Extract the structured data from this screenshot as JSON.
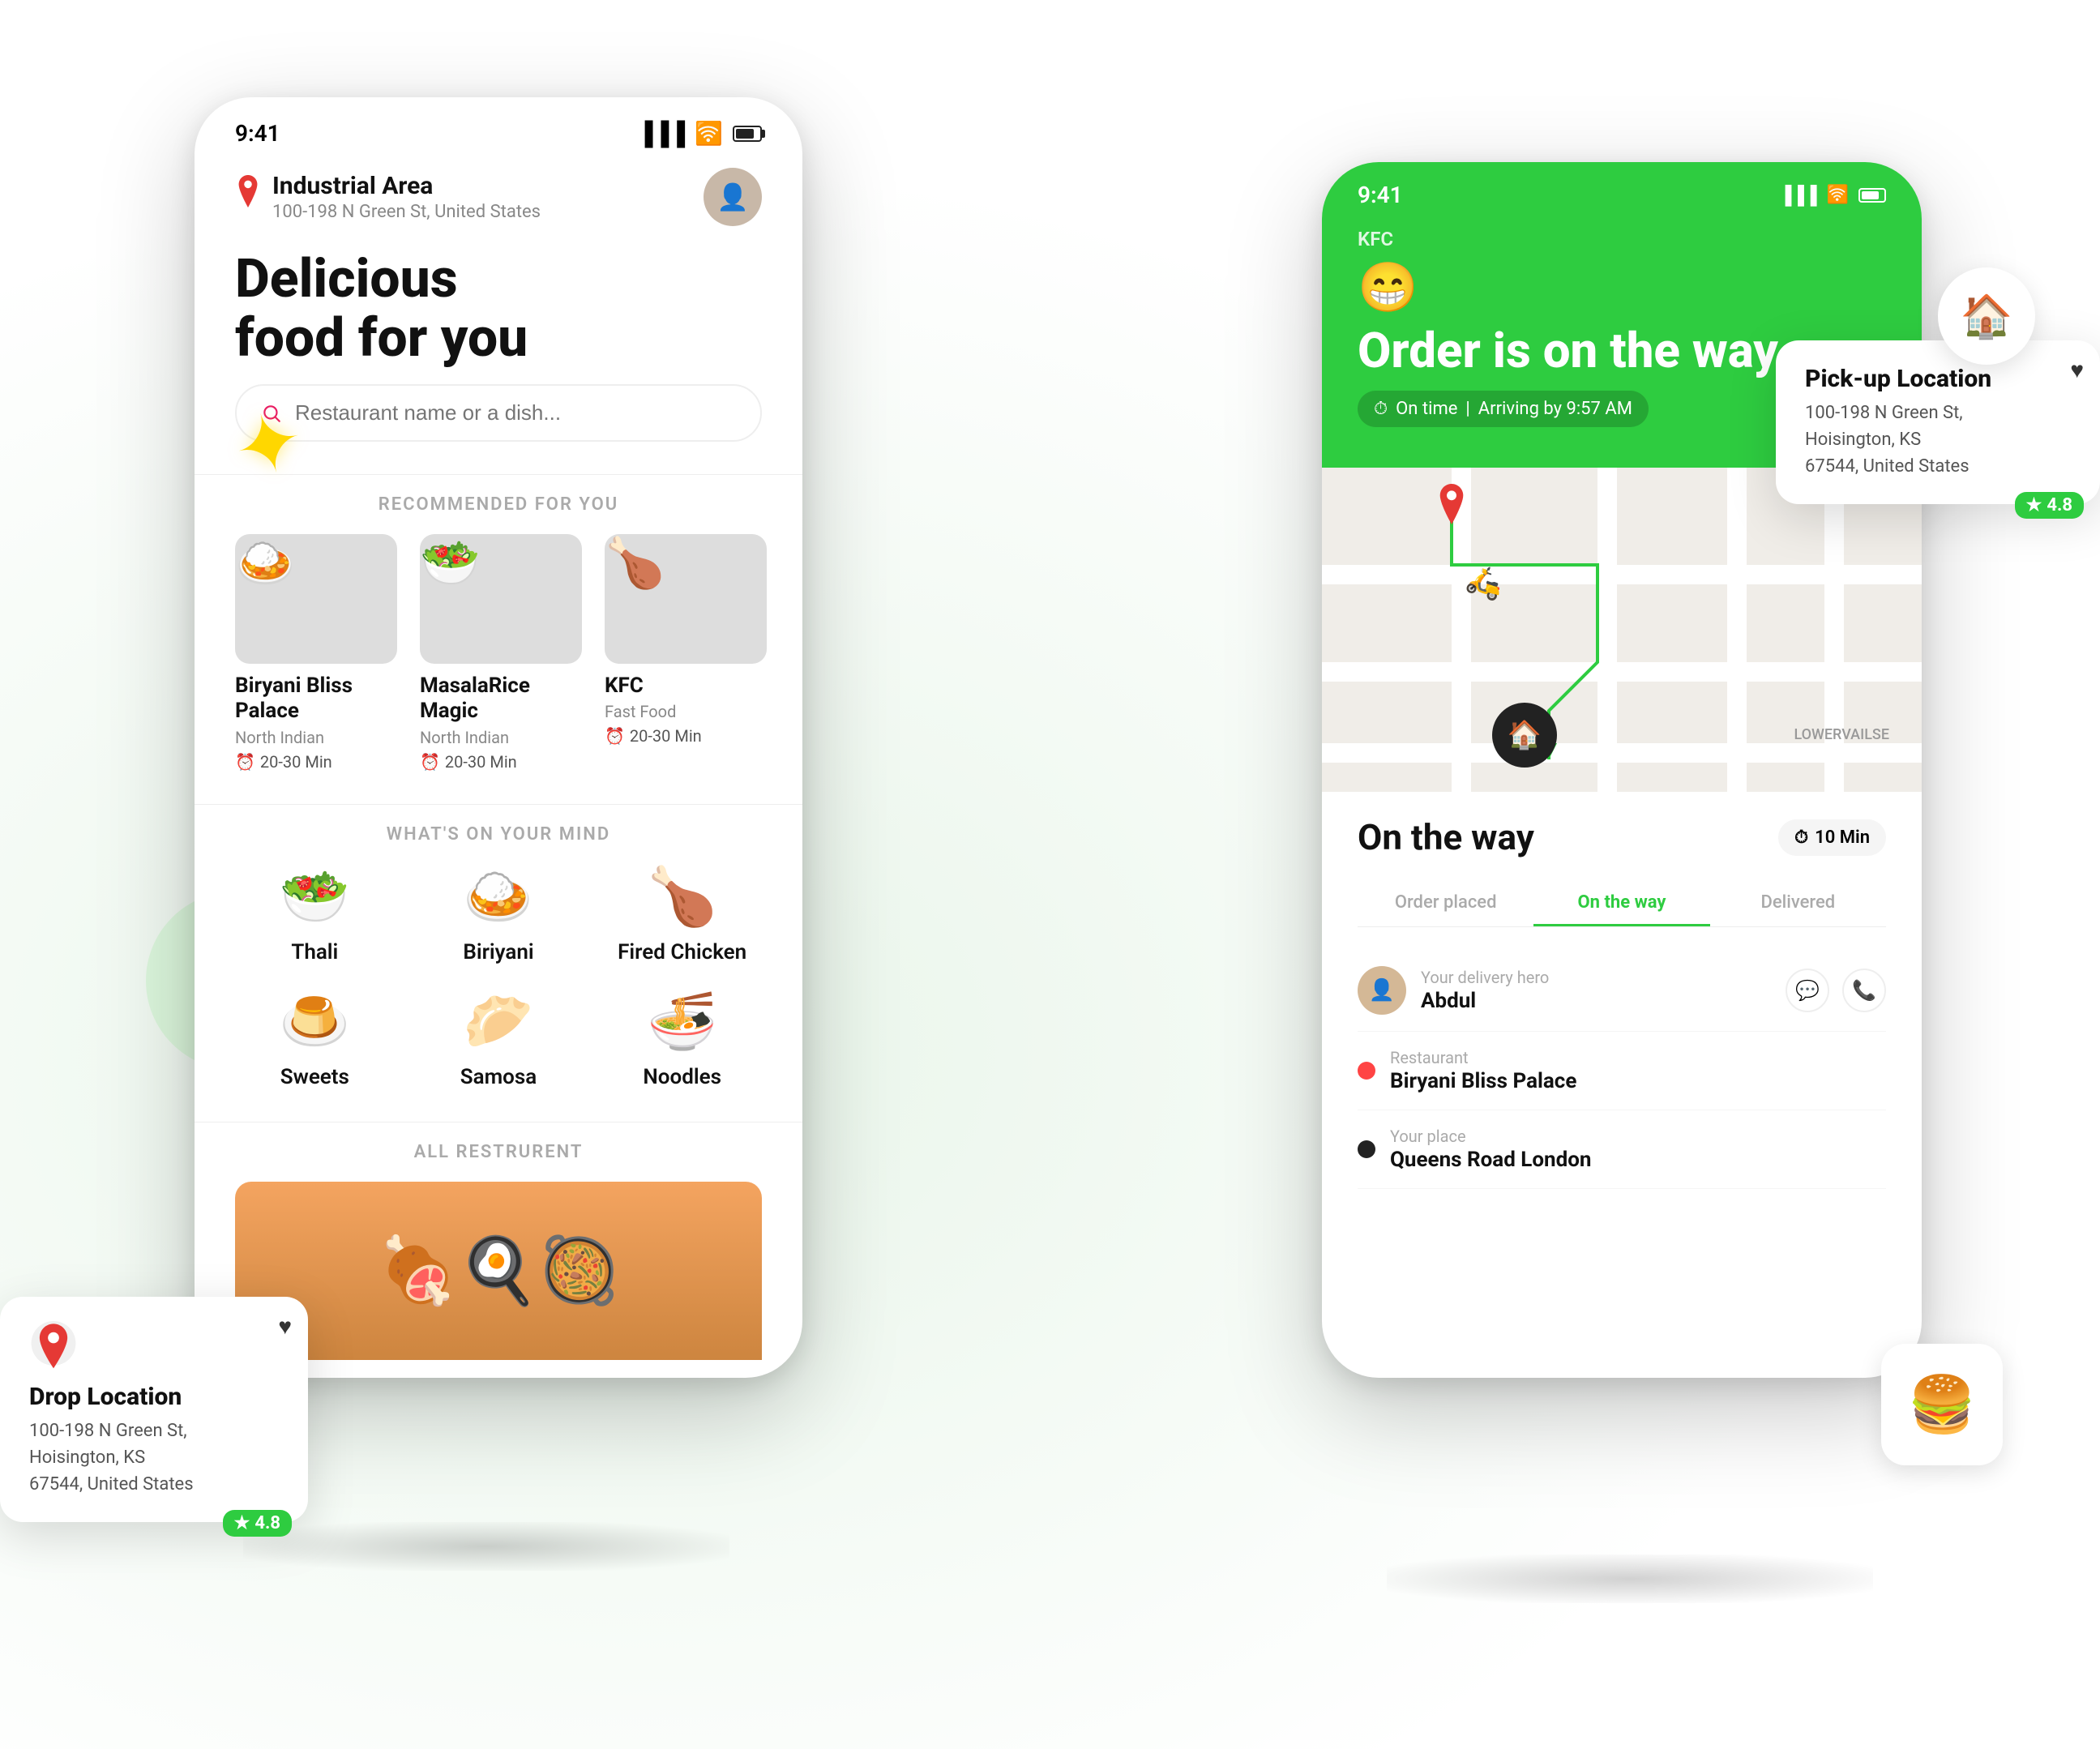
{
  "phone_main": {
    "status_time": "9:41",
    "location_name": "Industrial Area",
    "location_address": "100-198 N Green St, United States",
    "heading_line1": "Delicious",
    "heading_line2": "food for you",
    "search_placeholder": "Restaurant name or a dish...",
    "sections": {
      "recommended_label": "RECOMMENDED FOR YOU",
      "whats_on_mind_label": "WHAT'S ON YOUR MIND",
      "all_restaurant_label": "ALL RESTRURENT"
    },
    "restaurants": [
      {
        "name": "Biryani Bliss Palace",
        "cuisine": "North Indian",
        "time": "20-30 Min",
        "emoji": "🍛"
      },
      {
        "name": "MasalaRice Magic",
        "cuisine": "North Indian",
        "time": "20-30 Min",
        "emoji": "🥗"
      },
      {
        "name": "KFC",
        "cuisine": "Fast Food",
        "time": "20-30 Min",
        "emoji": "🍗"
      }
    ],
    "categories": [
      {
        "name": "Thali",
        "emoji": "🥗"
      },
      {
        "name": "Biriyani",
        "emoji": "🍛"
      },
      {
        "name": "Fired Chicken",
        "emoji": "🍗"
      },
      {
        "name": "Sweets",
        "emoji": "🍮"
      },
      {
        "name": "Samosa",
        "emoji": "🥟"
      },
      {
        "name": "Noodles",
        "emoji": "🍜"
      }
    ]
  },
  "phone_order": {
    "status_time": "9:41",
    "kfc_label": "KFC",
    "order_title": "Order is on the way",
    "on_time_text": "On time",
    "arriving_text": "Arriving by 9:57 AM",
    "tracking": {
      "section_title": "On the way",
      "time_badge": "10 Min",
      "tabs": [
        "Order placed",
        "On the way",
        "Delivered"
      ]
    },
    "delivery_hero": {
      "label": "Your delivery hero",
      "name": "Abdul"
    },
    "restaurant": {
      "label": "Restaurant",
      "name": "Biryani Bliss Palace"
    },
    "destination": {
      "label": "Your place",
      "name": "Queens Road London"
    }
  },
  "float_drop": {
    "title": "Drop Location",
    "address": "100-198 N Green St,\nHoisington, KS\n67544, United States",
    "rating": "4.8"
  },
  "float_pickup": {
    "title": "Pick-up Location",
    "address": "100-198 N Green St,\nHoisington, KS\n67544, United States",
    "rating": "4.8"
  }
}
